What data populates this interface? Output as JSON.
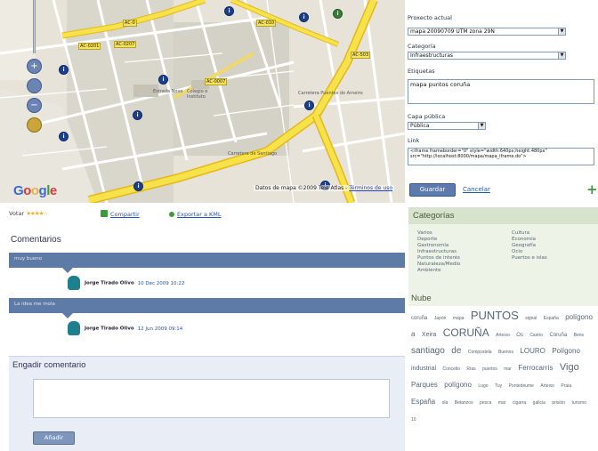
{
  "map": {
    "labels": [
      "AC-0",
      "AC-0201",
      "AC-0207",
      "AC-010",
      "AC-503",
      "AC-0007",
      "Carretera de Santiago",
      "Carretera Puentes do Arneiro",
      "Estrada Novo",
      "Colegio e Instituto"
    ],
    "copyright": "Datos de mapa ©2009 Tele Atlas -",
    "copyright_link": "Términos de uso",
    "google_logo": "Google",
    "zoom_in": "+",
    "zoom_out": "−"
  },
  "form": {
    "project_label": "Proxecto actual",
    "project_value": "mapa 20090709 UTM zona 29N",
    "category_label": "Categoría",
    "category_value": "Infraestructuras",
    "etiquetas_label": "Etiquetas",
    "etiquetas_value": "mapa puntos coruña",
    "caps_label": "Capa pública",
    "caps_value": "Pública",
    "link_label": "Link",
    "link_value": "<iframe frameborder=\"0\" style=\"width:640px;height:480px\" src=\"http://localhost:8000/mapa/mapa_iframe.do\">",
    "guardar": "Guardar",
    "cancelar": "Cancelar",
    "add_icon": "plus-icon"
  },
  "toolbar": {
    "vote_label": "Votar",
    "stars": "★★★★☆",
    "compartir": "Compartir",
    "exportar": "Exportar a KML"
  },
  "comments": {
    "heading": "Comentarios",
    "items": [
      {
        "text": "muy bueno",
        "user": "Jorge Tirado Olivo",
        "date": "10 Dec 2009 10:22"
      },
      {
        "text": "La idea me mola",
        "user": "Jorge Tirado Olivo",
        "date": "12 Jun 2009 09:14"
      }
    ]
  },
  "add_comment": {
    "heading": "Engadir comentario",
    "button": "Añadir"
  },
  "categories": {
    "heading": "Categorías",
    "col1": [
      "Varios",
      "Deporte",
      "Gastronomía",
      "Infraestructuras",
      "Puntos de interés",
      "Naturaleza/Medio",
      "Ambiente"
    ],
    "col2": [
      "Cultura",
      "Economía",
      "Geografía",
      "Ocio",
      "Puertos e islas"
    ]
  },
  "nube": {
    "heading": "Nube",
    "tags": [
      {
        "t": "coruña",
        "s": 6
      },
      {
        "t": "Japón",
        "s": 5
      },
      {
        "t": "mapa",
        "s": 5
      },
      {
        "t": "PUNTOS",
        "s": 13
      },
      {
        "t": "signal",
        "s": 5
      },
      {
        "t": "España",
        "s": 5
      },
      {
        "t": "polígono",
        "s": 8
      },
      {
        "t": "a",
        "s": 8
      },
      {
        "t": "Xeira",
        "s": 7
      },
      {
        "t": "CORUÑA",
        "s": 12
      },
      {
        "t": "Arteixo",
        "s": 5
      },
      {
        "t": "Os",
        "s": 6
      },
      {
        "t": "Castro",
        "s": 5
      },
      {
        "t": "Coruña",
        "s": 6
      },
      {
        "t": "Bens",
        "s": 5
      },
      {
        "t": "santiago",
        "s": 10
      },
      {
        "t": "de",
        "s": 10
      },
      {
        "t": "Compostela",
        "s": 5
      },
      {
        "t": "Buenos",
        "s": 5
      },
      {
        "t": "LOURO",
        "s": 8
      },
      {
        "t": "Polígono",
        "s": 8
      },
      {
        "t": "industrial",
        "s": 7
      },
      {
        "t": "Concello",
        "s": 5
      },
      {
        "t": "Rías",
        "s": 5
      },
      {
        "t": "puertos",
        "s": 5
      },
      {
        "t": "mar",
        "s": 5
      },
      {
        "t": "Ferrocarrís",
        "s": 8
      },
      {
        "t": "Vigo",
        "s": 11
      },
      {
        "t": "Parques",
        "s": 8
      },
      {
        "t": "polígono",
        "s": 8
      },
      {
        "t": "Lugo",
        "s": 5
      },
      {
        "t": "Tuy",
        "s": 5
      },
      {
        "t": "Pontedeume",
        "s": 5
      },
      {
        "t": "Arteixo",
        "s": 5
      },
      {
        "t": "Praia",
        "s": 5
      },
      {
        "t": "España",
        "s": 8
      },
      {
        "t": "ola",
        "s": 5
      },
      {
        "t": "Betanzos",
        "s": 5
      },
      {
        "t": "pesca",
        "s": 5
      },
      {
        "t": "mar",
        "s": 5
      },
      {
        "t": "cigarra",
        "s": 5
      },
      {
        "t": "galicia",
        "s": 5
      },
      {
        "t": "prisión",
        "s": 5
      },
      {
        "t": "turismo",
        "s": 5
      },
      {
        "t": "10",
        "s": 5
      }
    ]
  }
}
